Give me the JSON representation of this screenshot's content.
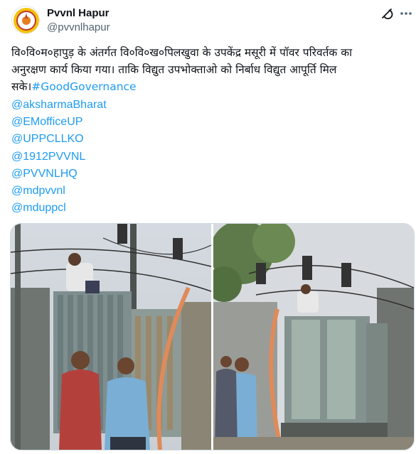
{
  "author": {
    "name": "Pvvnl Hapur",
    "handle": "@pvvnlhapur"
  },
  "icons": {
    "avatar": "pvvnl-logo",
    "grok": "grok-icon",
    "more": "more-dots-icon"
  },
  "tweet": {
    "line1": "वि०वि०म०हापुड़ के अंतर्गत वि०वि०ख०पिलखुवा के उपकेंद्र मसूरी में पॉवर परिवर्तक का",
    "line2": "अनुरक्षण कार्य किया गया। ताकि विद्युत उपभोक्ताओ को निर्बाध विद्युत आपूर्ति मिल",
    "line3_text": "सके।",
    "hashtag": "#GoodGovernance",
    "mentions": [
      "@aksharmaBharat",
      "@EMofficeUP",
      "@UPPCLLKO",
      "@1912PVVNL",
      "@PVVNLHQ",
      "@mdpvvnl",
      "@mduppcl"
    ]
  },
  "media": {
    "photos": [
      "transformer-maintenance-photo-1",
      "transformer-maintenance-photo-2"
    ]
  },
  "colors": {
    "link": "#1d9bf0",
    "text": "#0f1419",
    "secondary": "#536471",
    "border": "#cfd9de"
  }
}
